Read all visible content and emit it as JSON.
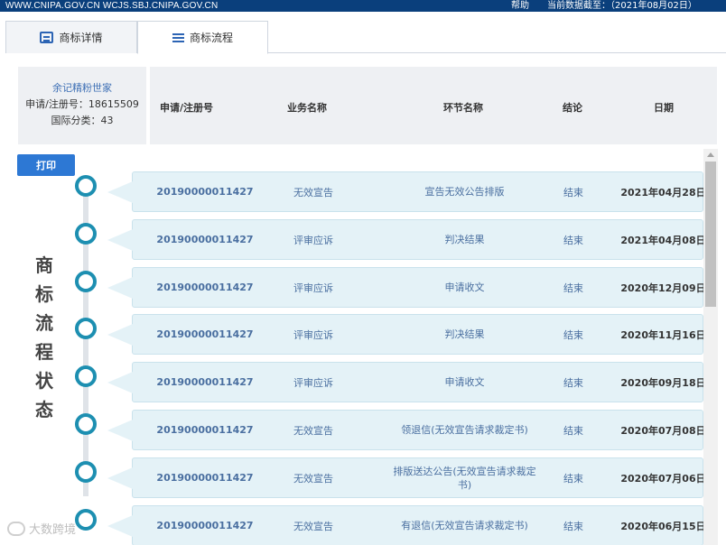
{
  "topbar": {
    "domains": "WWW.CNIPA.GOV.CN WCJS.SBJ.CNIPA.GOV.CN",
    "help": "帮助",
    "data_date": "当前数据截至：（2021年08月02日）"
  },
  "tabs": [
    {
      "label": "商标详情",
      "icon": "document-icon"
    },
    {
      "label": "商标流程",
      "icon": "list-icon"
    }
  ],
  "trademark": {
    "name": "余记精粉世家",
    "reg_line": "申请/注册号：18615509",
    "class_line": "国际分类：43"
  },
  "table_headers": {
    "reg_no": "申请/注册号",
    "business": "业务名称",
    "step": "环节名称",
    "result": "结论",
    "date": "日期"
  },
  "print_label": "打印",
  "vertical_title": [
    "商",
    "标",
    "流",
    "程",
    "状",
    "态"
  ],
  "rows": [
    {
      "reg_no": "20190000011427",
      "business": "无效宣告",
      "step": "宣告无效公告排版",
      "result": "结束",
      "date": "2021年04月28日"
    },
    {
      "reg_no": "20190000011427",
      "business": "评审应诉",
      "step": "判决结果",
      "result": "结束",
      "date": "2021年04月08日"
    },
    {
      "reg_no": "20190000011427",
      "business": "评审应诉",
      "step": "申请收文",
      "result": "结束",
      "date": "2020年12月09日"
    },
    {
      "reg_no": "20190000011427",
      "business": "评审应诉",
      "step": "判决结果",
      "result": "结束",
      "date": "2020年11月16日"
    },
    {
      "reg_no": "20190000011427",
      "business": "评审应诉",
      "step": "申请收文",
      "result": "结束",
      "date": "2020年09月18日"
    },
    {
      "reg_no": "20190000011427",
      "business": "无效宣告",
      "step": "领退信(无效宣告请求裁定书)",
      "result": "结束",
      "date": "2020年07月08日"
    },
    {
      "reg_no": "20190000011427",
      "business": "无效宣告",
      "step": "排版送达公告(无效宣告请求裁定书)",
      "result": "结束",
      "date": "2020年07月06日"
    },
    {
      "reg_no": "20190000011427",
      "business": "无效宣告",
      "step": "有退信(无效宣告请求裁定书)",
      "result": "结束",
      "date": "2020年06月15日"
    }
  ],
  "watermark": "大数跨境",
  "colors": {
    "topbar": "#0a3f7c",
    "accent": "#2d78d4",
    "node": "#1d8fb1",
    "row_bg": "#e4f2f7"
  }
}
